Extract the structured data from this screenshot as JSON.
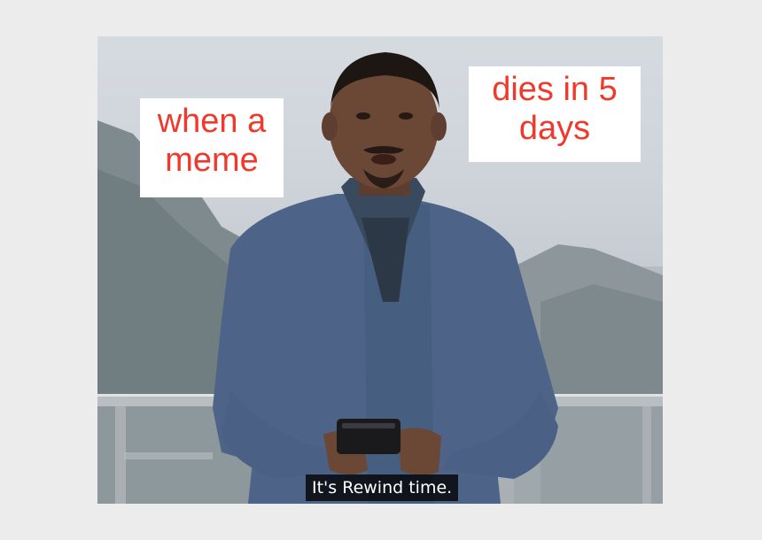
{
  "captions": {
    "left": "when a meme",
    "right": "dies in 5 days"
  },
  "subtitle": "It's Rewind time.",
  "colors": {
    "caption_text": "#f0392b",
    "caption_bg": "#ffffff",
    "jacket": "#4d6488",
    "subtitle_bg": "#000000"
  }
}
